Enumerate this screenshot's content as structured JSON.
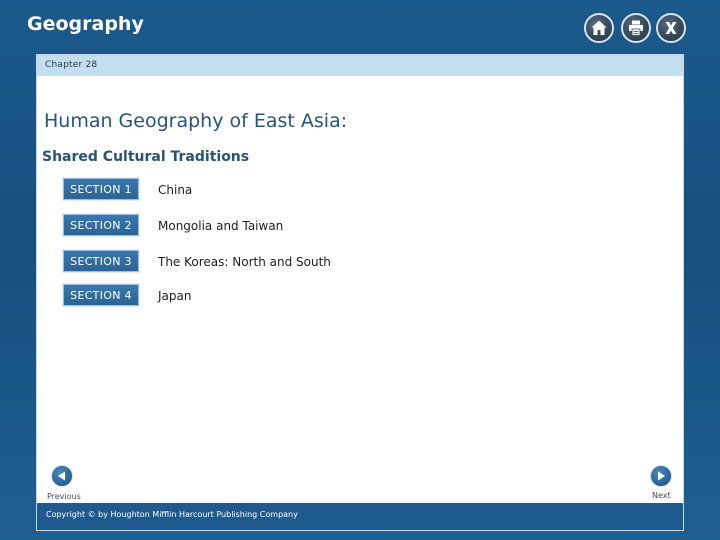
{
  "header": {
    "app_title": "Geography"
  },
  "icons": {
    "home": "home-icon",
    "print": "printer-icon",
    "close": "close-icon",
    "previous": "left-arrow-icon",
    "next": "right-arrow-icon"
  },
  "content": {
    "chapter_label": "Chapter 28",
    "title": "Human Geography of East Asia:",
    "subtitle": "Shared Cultural Traditions",
    "sections": [
      {
        "button": "SECTION 1",
        "text": "China"
      },
      {
        "button": "SECTION 2",
        "text": "Mongolia and Taiwan"
      },
      {
        "button": "SECTION 3",
        "text": "The Koreas: North and South"
      },
      {
        "button": "SECTION 4",
        "text": "Japan"
      }
    ]
  },
  "navigation": {
    "previous_label": "Previous",
    "next_label": "Next"
  },
  "footer": {
    "copyright": "Copyright © by Houghton Mifflin Harcourt Publishing Company"
  },
  "colors": {
    "background": "#1b5a8c",
    "title_blue": "#27547d",
    "chapter_bar": "#c3dfee",
    "section_button": "#3a78ad",
    "footer": "#1f5a8e"
  }
}
